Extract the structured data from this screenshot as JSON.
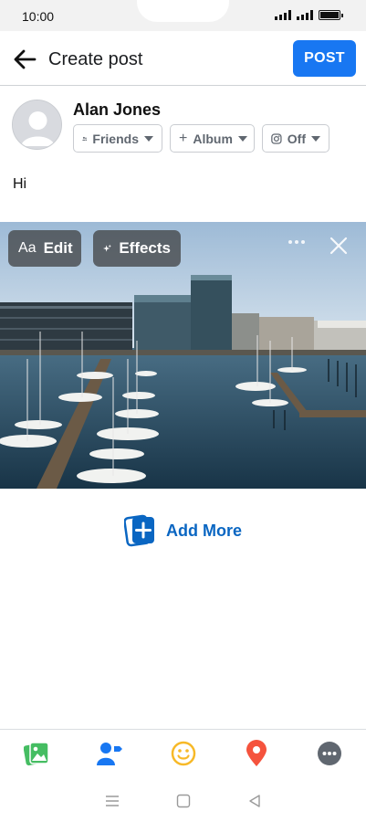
{
  "status": {
    "time": "10:00"
  },
  "header": {
    "title": "Create post",
    "post_label": "POST"
  },
  "user": {
    "name": "Alan Jones",
    "audience_chip": "Friends",
    "album_chip": "Album",
    "instagram_chip": "Off"
  },
  "post": {
    "text": "Hi"
  },
  "photo": {
    "edit_prefix": "Aa",
    "edit_label": "Edit",
    "effects_label": "Effects"
  },
  "add_more": {
    "label": "Add More"
  },
  "toolbar": {
    "items": [
      {
        "name": "photo-video",
        "icon": "gallery-icon",
        "color": "#45bd62"
      },
      {
        "name": "tag-people",
        "icon": "tag-people-icon",
        "color": "#1877f2"
      },
      {
        "name": "feeling",
        "icon": "smiley-icon",
        "color": "#f7b928"
      },
      {
        "name": "check-in",
        "icon": "location-pin-icon",
        "color": "#f5533d"
      },
      {
        "name": "more",
        "icon": "more-icon",
        "color": "#606770"
      }
    ]
  },
  "colors": {
    "accent": "#1877f2",
    "link": "#0a66c2"
  }
}
